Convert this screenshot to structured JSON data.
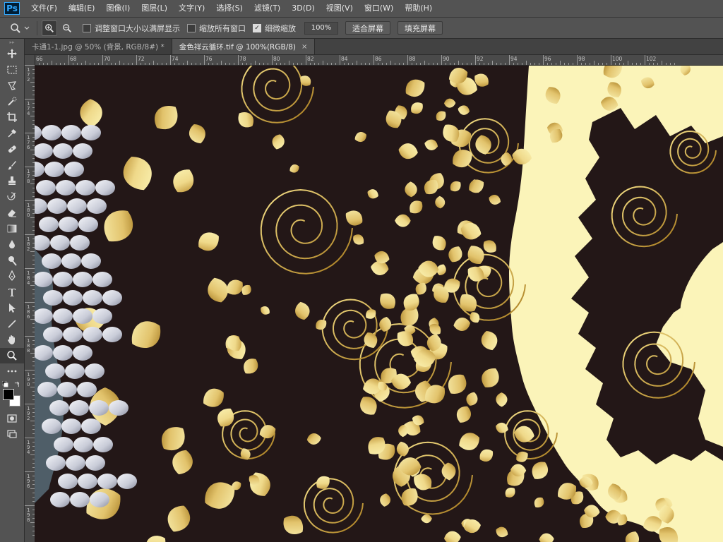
{
  "app": {
    "logo": "Ps"
  },
  "menu": [
    "文件(F)",
    "编辑(E)",
    "图像(I)",
    "图层(L)",
    "文字(Y)",
    "选择(S)",
    "滤镜(T)",
    "3D(D)",
    "视图(V)",
    "窗口(W)",
    "帮助(H)"
  ],
  "options": {
    "tool_icon": "zoom-icon",
    "resize_windows_label": "调整窗口大小以满屏显示",
    "resize_windows_checked": false,
    "zoom_all_label": "缩放所有窗口",
    "zoom_all_checked": false,
    "scrubby_label": "细微缩放",
    "scrubby_checked": true,
    "zoom_value": "100%",
    "fit_screen_label": "适合屏幕",
    "fill_screen_label": "填充屏幕"
  },
  "tabs": [
    {
      "label": "卡通1-1.jpg @ 50% (背景, RGB/8#) *",
      "active": false
    },
    {
      "label": "金色祥云循环.tif @ 100%(RGB/8)",
      "active": true
    }
  ],
  "tab_close_glyph": "×",
  "ruler_top": [
    "66",
    "68",
    "70",
    "72",
    "74",
    "76",
    "78",
    "80",
    "82",
    "84",
    "86",
    "88",
    "90",
    "92",
    "94",
    "96",
    "98",
    "100",
    "102"
  ],
  "ruler_left": [
    "1 7 2",
    "1 7 4",
    "1 7 6",
    "1 7 8",
    "1 8 0",
    "1 8 2",
    "1 8 4",
    "1 8 6",
    "1 8 8",
    "1 9 0",
    "1 9 2",
    "1 9 4",
    "1 9 6",
    "1 9 8"
  ],
  "colors": {
    "canvas_bg": "#231717",
    "gold_light": "#f7eeae",
    "gold_mid": "#e3c56a",
    "gold_dark": "#b88a2a",
    "silver": "#d6d9e4",
    "cream": "#fbf4b9",
    "ui_panel": "#535353"
  }
}
